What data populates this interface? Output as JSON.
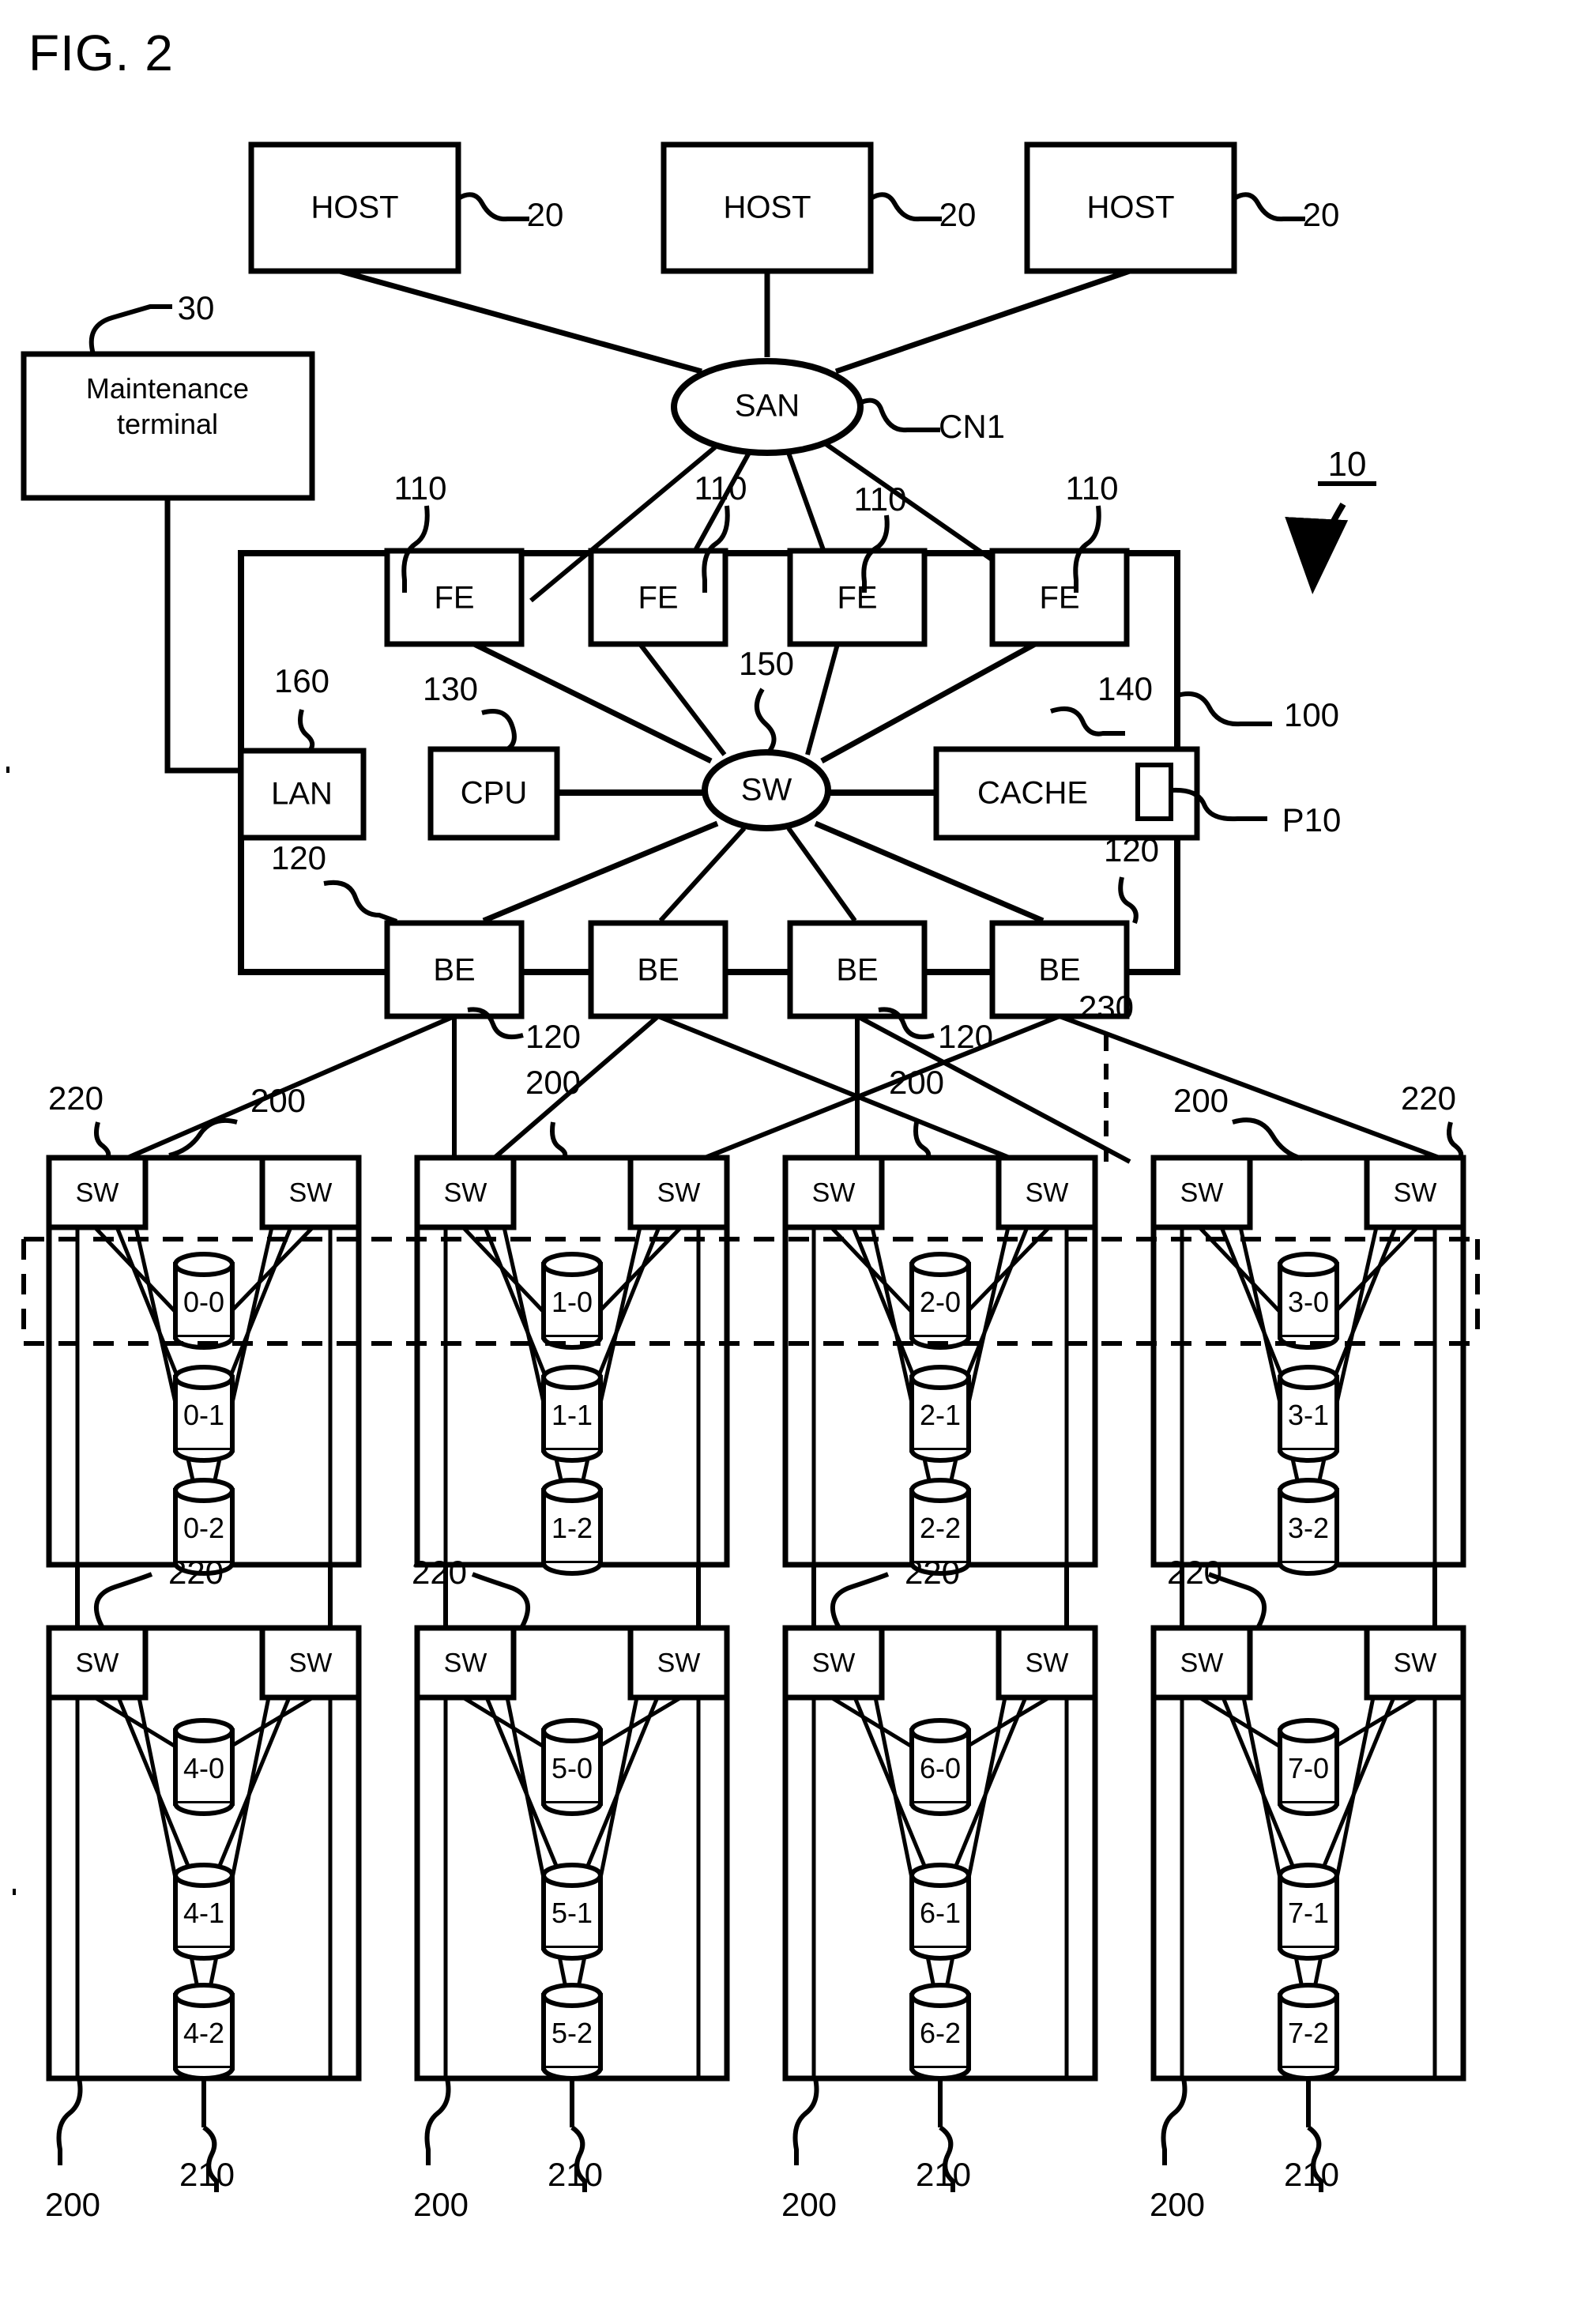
{
  "figure": {
    "title": "FIG. 2",
    "system_ref": "10"
  },
  "hosts": [
    {
      "label": "HOST",
      "ref": "20"
    },
    {
      "label": "HOST",
      "ref": "20"
    },
    {
      "label": "HOST",
      "ref": "20"
    }
  ],
  "network": {
    "san_label": "SAN",
    "san_ref": "CN1"
  },
  "maintenance": {
    "line1": "Maintenance",
    "line2": "terminal",
    "ref": "30"
  },
  "controller": {
    "ref": "100",
    "front_ends": [
      {
        "label": "FE",
        "ref": "110"
      },
      {
        "label": "FE",
        "ref": "110"
      },
      {
        "label": "FE",
        "ref": "110"
      },
      {
        "label": "FE",
        "ref": "110"
      }
    ],
    "back_ends": [
      {
        "label": "BE",
        "ref": "120"
      },
      {
        "label": "BE",
        "ref": "120"
      },
      {
        "label": "BE",
        "ref": "120"
      },
      {
        "label": "BE",
        "ref": "120"
      }
    ],
    "lan": {
      "label": "LAN",
      "ref": "160"
    },
    "cpu": {
      "label": "CPU",
      "ref": "130"
    },
    "switch": {
      "label": "SW",
      "ref": "150"
    },
    "cache": {
      "label": "CACHE",
      "ref": "140",
      "port_ref": "P10"
    }
  },
  "enclosures": [
    {
      "id": "enc-0",
      "sw_left": "SW",
      "sw_right": "SW",
      "ref_enclosure": "200",
      "ref_switch": "220",
      "ref_disk": "210",
      "disks": [
        "0-0",
        "0-1",
        "0-2"
      ]
    },
    {
      "id": "enc-1",
      "sw_left": "SW",
      "sw_right": "SW",
      "ref_enclosure": "200",
      "ref_switch": "220",
      "ref_disk": "210",
      "disks": [
        "1-0",
        "1-1",
        "1-2"
      ]
    },
    {
      "id": "enc-2",
      "sw_left": "SW",
      "sw_right": "SW",
      "ref_enclosure": "200",
      "ref_switch": "220",
      "ref_disk": "210",
      "disks": [
        "2-0",
        "2-1",
        "2-2"
      ]
    },
    {
      "id": "enc-3",
      "sw_left": "SW",
      "sw_right": "SW",
      "ref_enclosure": "200",
      "ref_switch": "220",
      "ref_disk": "210",
      "disks": [
        "3-0",
        "3-1",
        "3-2"
      ]
    },
    {
      "id": "enc-4",
      "sw_left": "SW",
      "sw_right": "SW",
      "ref_enclosure": "200",
      "ref_switch": "220",
      "ref_disk": "210",
      "disks": [
        "4-0",
        "4-1",
        "4-2"
      ]
    },
    {
      "id": "enc-5",
      "sw_left": "SW",
      "sw_right": "SW",
      "ref_enclosure": "200",
      "ref_switch": "220",
      "ref_disk": "210",
      "disks": [
        "5-0",
        "5-1",
        "5-2"
      ]
    },
    {
      "id": "enc-6",
      "sw_left": "SW",
      "sw_right": "SW",
      "ref_enclosure": "200",
      "ref_switch": "220",
      "ref_disk": "210",
      "disks": [
        "6-0",
        "6-1",
        "6-2"
      ]
    },
    {
      "id": "enc-7",
      "sw_left": "SW",
      "sw_right": "SW",
      "ref_enclosure": "200",
      "ref_switch": "220",
      "ref_disk": "210",
      "disks": [
        "7-0",
        "7-1",
        "7-2"
      ]
    }
  ],
  "raid_group": {
    "ref": "230",
    "members": [
      "0-0",
      "1-0",
      "2-0",
      "3-0"
    ]
  },
  "labels": {
    "ref_110": "110",
    "ref_120": "120",
    "ref_200": "200",
    "ref_210": "210",
    "ref_220": "220",
    "ref_230": "230"
  },
  "colors": {
    "ink": "#000000",
    "paper": "#ffffff"
  }
}
